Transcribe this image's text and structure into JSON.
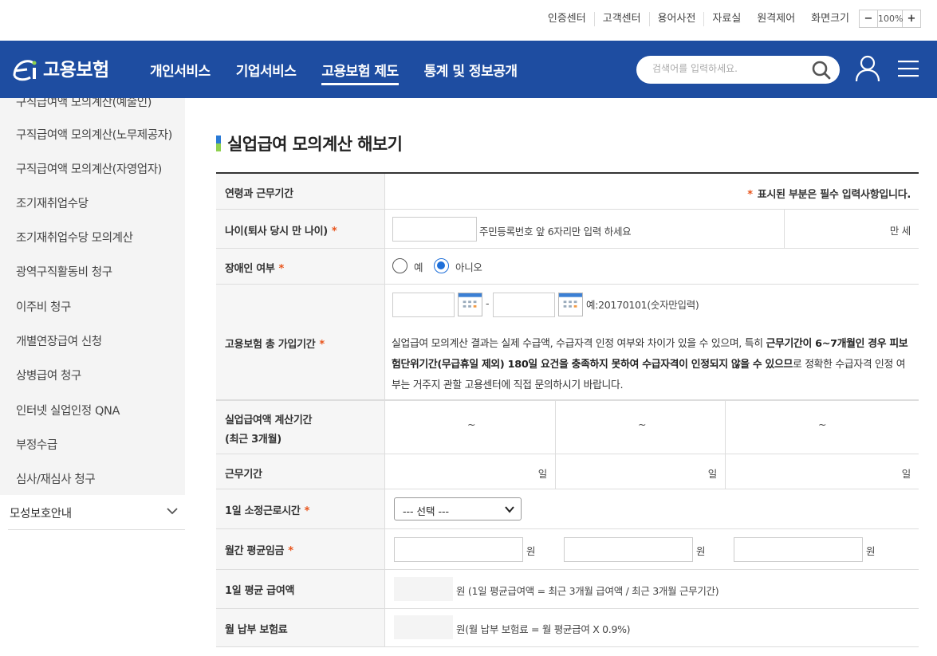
{
  "util": {
    "links": [
      "인증센터",
      "고객센터",
      "용어사전",
      "자료실",
      "원격제어"
    ],
    "zoom_label": "화면크기",
    "zoom_minus": "−",
    "zoom_value": "100%",
    "zoom_plus": "+"
  },
  "header": {
    "logo_text": "고용보험",
    "nav": [
      "개인서비스",
      "기업서비스",
      "고용보험 제도",
      "통계 및 정보공개"
    ],
    "active_nav": "고용보험 제도",
    "search_placeholder": "검색어를 입력하세요.",
    "bg_color": "#1e4da1"
  },
  "sidebar": {
    "items": [
      "구직급여액 모의계산(예술인)",
      "구직급여액 모의계산(노무제공자)",
      "구직급여액 모의계산(자영업자)",
      "조기재취업수당",
      "조기재취업수당 모의계산",
      "광역구직활동비 청구",
      "이주비 청구",
      "개별연장급여 신청",
      "상병급여 청구",
      "인터넷 실업인정 QNA",
      "부정수급",
      "심사/재심사 청구"
    ],
    "group_label": "모성보호안내"
  },
  "main": {
    "title": "실업급여 모의계산 해보기",
    "required_star": "*",
    "rows": {
      "section_label": "연령과 근무기간",
      "required_notice": "표시된 부분은 필수 입력사항입니다.",
      "age_label": "나이(퇴사 당시 만 나이)",
      "age_hint": "주민등록번호 앞 6자리만 입력 하세요",
      "age_unit": "만 세",
      "disabled_label": "장애인 여부",
      "disabled_yes": "예",
      "disabled_no": "아니오",
      "disabled_selected": "아니오",
      "period_label": "고용보험 총 가입기간",
      "period_sep": "-",
      "period_example": "예:20170101(숫자만입력)",
      "warn_1": "실업급여 모의계산 결과는 실제 수급액, 수급자격 인정 여부와 차이가 있을 수 있으며, 특히 ",
      "warn_bold_1": "근무기간이 6~7개월인 경우 피보험단위기간(무급휴일 제외) 180일 요건을 충족하지 못하여 수급자격이 인정되지 않을 수 있으므",
      "warn_2": "로 정확한 수급자격 인정 여부는 거주지 관할 고용센터에 직접 문의하시기 바랍니다.",
      "calc_period_label_1": "실업급여액 계산기간",
      "calc_period_label_2": "(최근 3개월)",
      "tilde": "~",
      "work_days_label": "근무기간",
      "day_unit": "일",
      "hours_label": "1일 소정근로시간",
      "hours_select": "--- 선택 ---",
      "wage_label": "월간 평균임금",
      "won_unit": "원",
      "daily_label": "1일 평균 급여액",
      "daily_formula": "원 (1일 평균급여액 = 최근 3개월 급여액 / 최근 3개월 근무기간)",
      "premium_label": "월 납부 보험료",
      "premium_formula": "원(월 납부 보험료 = 월 평균급여 X 0.9%)"
    }
  }
}
